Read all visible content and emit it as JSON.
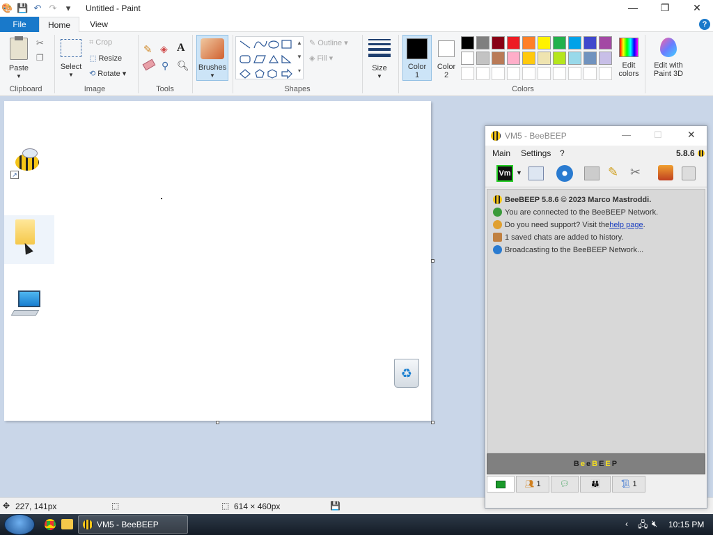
{
  "window": {
    "title": "Untitled - Paint"
  },
  "tabs": {
    "file": "File",
    "home": "Home",
    "view": "View",
    "help": "?"
  },
  "ribbon": {
    "clipboard": {
      "paste": "Paste",
      "label": "Clipboard"
    },
    "image": {
      "select": "Select",
      "crop": "Crop",
      "resize": "Resize",
      "rotate": "Rotate",
      "label": "Image"
    },
    "tools": {
      "label": "Tools"
    },
    "brushes": {
      "label": "Brushes"
    },
    "shapes": {
      "outline": "Outline",
      "fill": "Fill",
      "label": "Shapes"
    },
    "size": {
      "label": "Size"
    },
    "colors": {
      "color1": "Color 1",
      "color2": "Color 2",
      "edit": "Edit colors",
      "label": "Colors",
      "palette_row1": [
        "#000000",
        "#7f7f7f",
        "#880015",
        "#ed1c24",
        "#ff7f27",
        "#fff200",
        "#22b14c",
        "#00a2e8",
        "#3f48cc",
        "#a349a4"
      ],
      "palette_row2": [
        "#ffffff",
        "#c3c3c3",
        "#b97a57",
        "#ffaec9",
        "#ffc90e",
        "#efe4b0",
        "#b5e61d",
        "#99d9ea",
        "#7092be",
        "#c8bfe7"
      ]
    },
    "paint3d": "Edit with Paint 3D"
  },
  "status": {
    "cursor": "227, 141px",
    "size": "614 × 460px"
  },
  "taskbar": {
    "app": "VM5 - BeeBEEP",
    "time": "10:15 PM"
  },
  "beebeep": {
    "title": "VM5 - BeeBEEP",
    "menu": {
      "main": "Main",
      "settings": "Settings",
      "help": "?"
    },
    "version": "5.8.6",
    "vm_label": "Vm",
    "log": {
      "line1": "BeeBEEP 5.8.6 © 2023 Marco Mastroddi.",
      "line2": "You are connected to the BeeBEEP Network.",
      "line3_pre": "Do you need support? Visit the ",
      "line3_link": "help page",
      "line3_post": ".",
      "line4": "1 saved chats are added to history.",
      "line5": "Broadcasting to the BeeBEEP Network..."
    },
    "bar": "BeeBEEP",
    "tabs": {
      "users": "1",
      "chats": "1"
    }
  }
}
